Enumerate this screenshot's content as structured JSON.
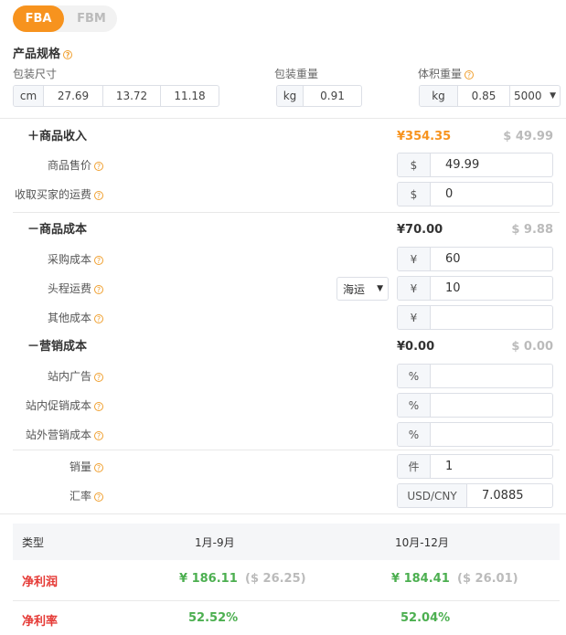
{
  "tabs": [
    {
      "label": "FBA",
      "active": true
    },
    {
      "label": "FBM",
      "active": false
    }
  ],
  "spec": {
    "title": "产品规格",
    "size_label": "包装尺寸",
    "size_unit": "cm",
    "dims": [
      "27.69",
      "13.72",
      "11.18"
    ],
    "weight_label": "包装重量",
    "weight_unit": "kg",
    "weight": "0.91",
    "vol_label": "体积重量",
    "vol_unit": "kg",
    "vol": "0.85",
    "divisor": "5000"
  },
  "income": {
    "title": "商品收入",
    "icon": "plus",
    "cny": "¥354.35",
    "usd": "$ 49.99",
    "price_label": "商品售价",
    "price_prefix": "$",
    "price": "49.99",
    "ship_label": "收取买家的运费",
    "ship_prefix": "$",
    "ship": "0"
  },
  "cost": {
    "title": "商品成本",
    "icon": "minus",
    "cny": "¥70.00",
    "usd": "$ 9.88",
    "purchase_label": "采购成本",
    "purchase_prefix": "¥",
    "purchase": "60",
    "freight_label": "头程运费",
    "freight_mode": "海运",
    "freight_prefix": "¥",
    "freight": "10",
    "other_label": "其他成本",
    "other_prefix": "¥",
    "other": ""
  },
  "marketing": {
    "title": "营销成本",
    "icon": "minus",
    "cny": "¥0.00",
    "usd": "$ 0.00",
    "ads_label": "站内广告",
    "promo_label": "站内促销成本",
    "offsite_label": "站外营销成本",
    "prefix": "%"
  },
  "sales": {
    "label": "销量",
    "prefix": "件",
    "value": "1"
  },
  "rate": {
    "label": "汇率",
    "prefix": "USD/CNY",
    "value": "7.0885"
  },
  "table": {
    "headers": [
      "类型",
      "1月-9月",
      "10月-12月"
    ],
    "profit_label": "净利润",
    "profit": [
      {
        "cny": "¥ 186.11",
        "usd": "($ 26.25)"
      },
      {
        "cny": "¥ 184.41",
        "usd": "($ 26.01)"
      }
    ],
    "margin_label": "净利率",
    "margin": [
      "52.52%",
      "52.04%"
    ]
  },
  "colors": {
    "accent": "#f7931e",
    "profit": "#4caf50",
    "label_red": "#e53935"
  }
}
